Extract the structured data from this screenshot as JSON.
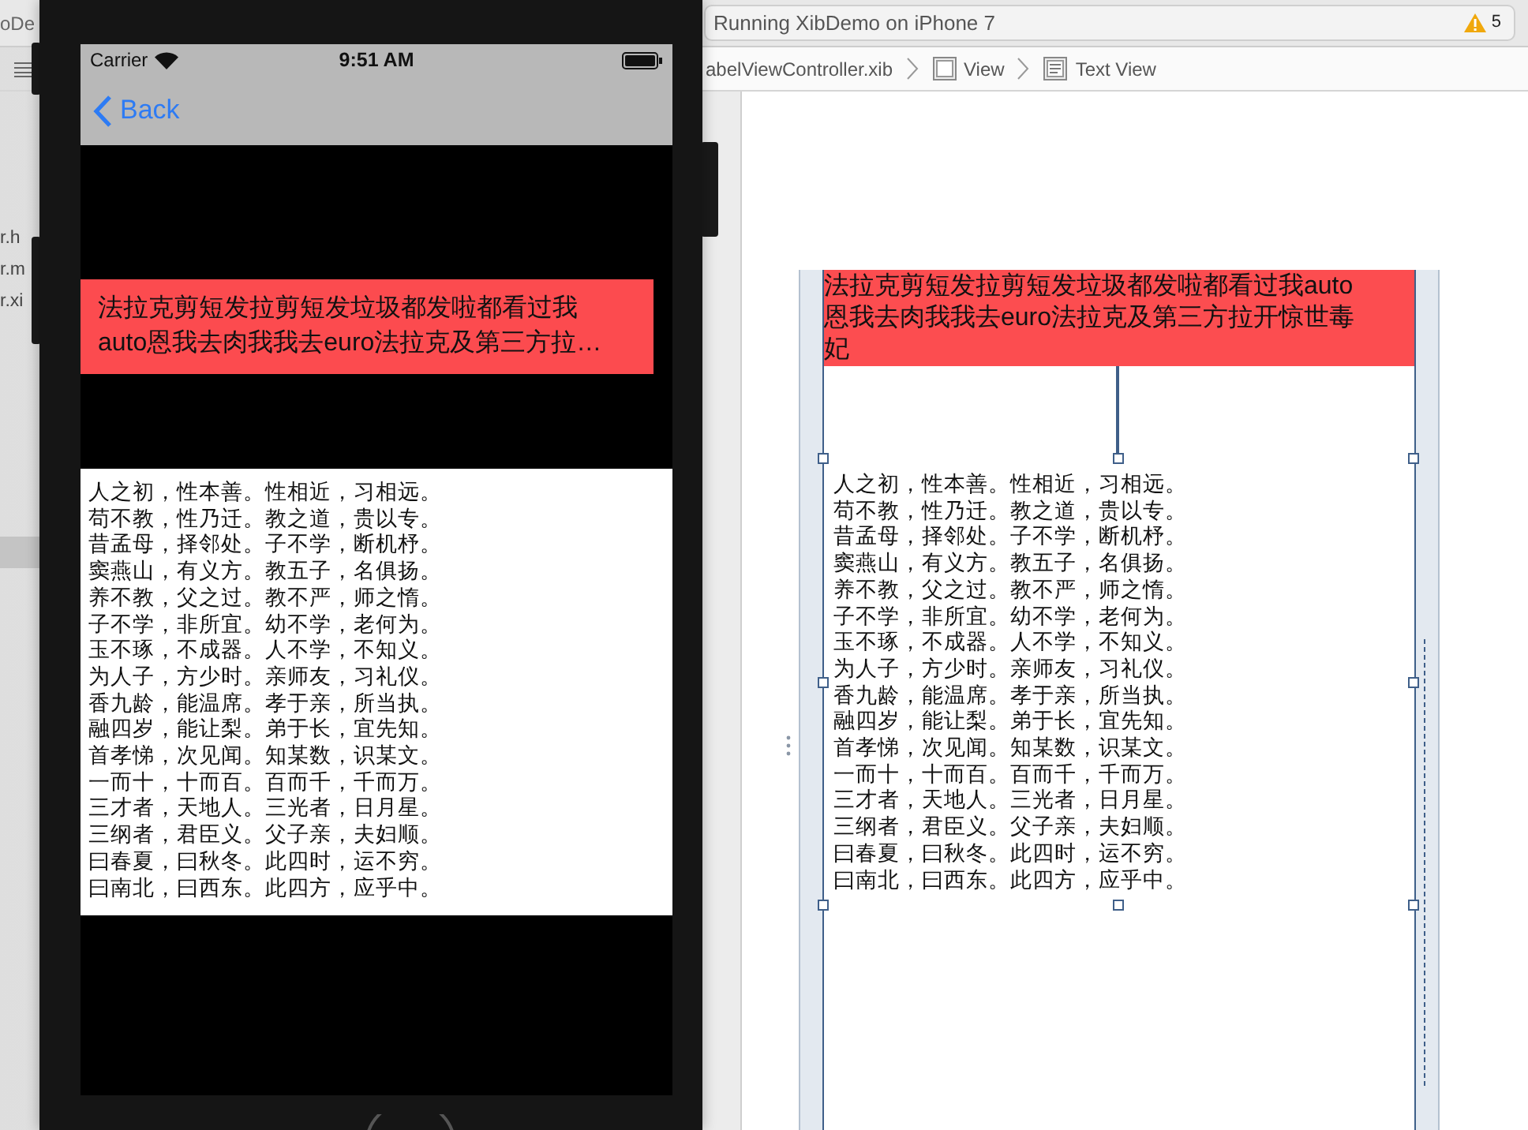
{
  "xcode": {
    "project_fragment": "oDe",
    "activity": "Running XibDemo on iPhone 7",
    "warning_count": "5",
    "navigator_files": [
      "r.h",
      "r.m",
      "r.xi"
    ],
    "breadcrumbs": [
      {
        "kind": "file",
        "label": "abelViewController.xib"
      },
      {
        "kind": "view",
        "label": "View"
      },
      {
        "kind": "textview",
        "label": "Text View"
      }
    ]
  },
  "simulator": {
    "carrier": "Carrier",
    "time": "9:51 AM",
    "back": "Back",
    "label_lines": [
      "法拉克剪短发拉剪短发垃圾都发啦都看过我",
      "auto恩我去肉我我去euro法拉克及第三方拉…"
    ],
    "text_view_lines": [
      "人之初，性本善。性相近，习相远。",
      "苟不教，性乃迁。教之道，贵以专。",
      "昔孟母，择邻处。子不学，断机杼。",
      "窦燕山，有义方。教五子，名俱扬。",
      "养不教，父之过。教不严，师之惰。",
      "子不学，非所宜。幼不学，老何为。",
      "玉不琢，不成器。人不学，不知义。",
      "为人子，方少时。亲师友，习礼仪。",
      "香九龄，能温席。孝于亲，所当执。",
      "融四岁，能让梨。弟于长，宜先知。",
      "首孝悌，次见闻。知某数，识某文。",
      "一而十，十而百。百而千，千而万。",
      "三才者，天地人。三光者，日月星。",
      "三纲者，君臣义。父子亲，夫妇顺。",
      "曰春夏，曰秋冬。此四时，运不穷。",
      "曰南北，曰西东。此四方，应乎中。"
    ]
  },
  "canvas": {
    "label_lines": [
      "法拉克剪短发拉剪短发垃圾都发啦都看过我auto",
      "恩我去肉我我去euro法拉克及第三方拉开惊世毒",
      "妃"
    ],
    "text_view_lines": [
      "人之初，性本善。性相近，习相远。",
      "苟不教，性乃迁。教之道，贵以专。",
      "昔孟母，择邻处。子不学，断机杼。",
      "窦燕山，有义方。教五子，名俱扬。",
      "养不教，父之过。教不严，师之惰。",
      "子不学，非所宜。幼不学，老何为。",
      "玉不琢，不成器。人不学，不知义。",
      "为人子，方少时。亲师友，习礼仪。",
      "香九龄，能温席。孝于亲，所当执。",
      "融四岁，能让梨。弟于长，宜先知。",
      "首孝悌，次见闻。知某数，识某文。",
      "一而十，十而百。百而千，千而万。",
      "三才者，天地人。三光者，日月星。",
      "三纲者，君臣义。父子亲，夫妇顺。",
      "曰春夏，曰秋冬。此四时，运不穷。",
      "曰南北，曰西东。此四方，应乎中。"
    ]
  }
}
